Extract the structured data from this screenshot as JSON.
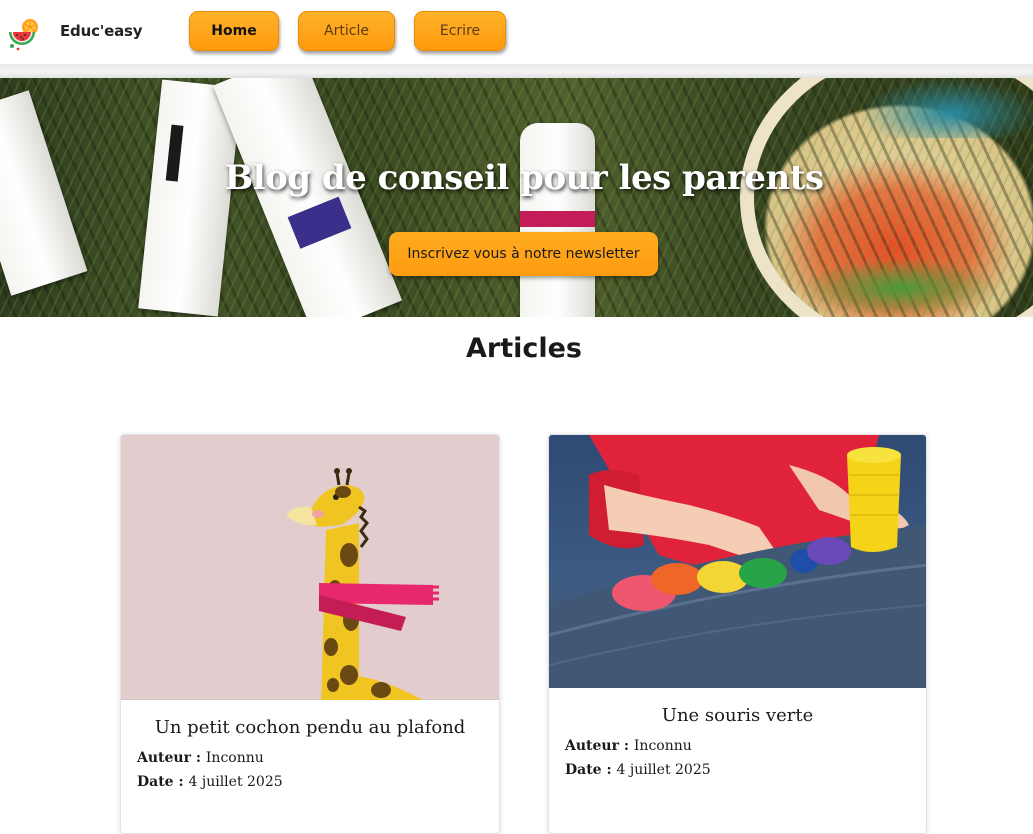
{
  "header": {
    "brand": "Educ'easy",
    "logo_icon": "watermelon-orange-logo-icon",
    "nav": [
      {
        "label": "Home",
        "active": true
      },
      {
        "label": "Article",
        "active": false
      },
      {
        "label": "Ecrire",
        "active": false
      }
    ],
    "accent_color": "#ffa515"
  },
  "hero": {
    "title": "Blog de conseil pour les parents",
    "button_label": "Inscrivez vous à notre newsletter"
  },
  "articles": {
    "heading": "Articles",
    "items": [
      {
        "title": "Un petit cochon pendu au plafond",
        "author_label": "Auteur :",
        "author": "Inconnu",
        "date_label": "Date :",
        "date": "4 juillet 2025",
        "image": "giraffe-with-scarf-illustration"
      },
      {
        "title": "Une souris verte",
        "author_label": "Auteur :",
        "author": "Inconnu",
        "date_label": "Date :",
        "date": "4 juillet 2025",
        "image": "child-playing-with-modeling-clay-photo"
      }
    ]
  }
}
